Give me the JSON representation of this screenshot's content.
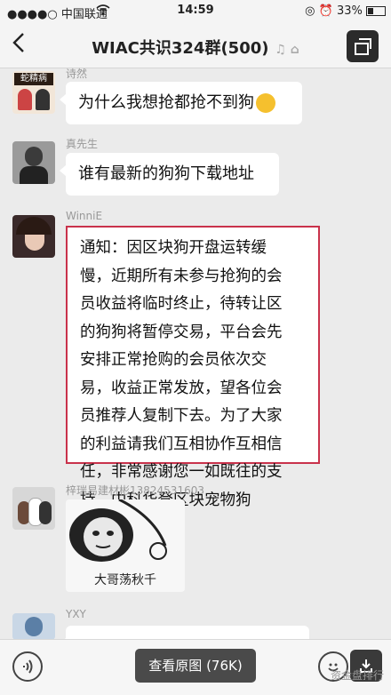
{
  "status_bar": {
    "carrier": "●●●●○ 中国联通",
    "time": "14:59",
    "battery": "33%"
  },
  "header": {
    "back_icon": "chevron-left",
    "title": "WIAC共识324群(500)",
    "more_icon": "window-switch-icon"
  },
  "messages": [
    {
      "sender": "诗然",
      "text": "为什么我想抢都抢不到狗"
    },
    {
      "sender": "真先生",
      "text": "谁有最新的狗狗下载地址"
    },
    {
      "sender": "WinniE",
      "lines": [
        "通知：因区块狗开盘运转缓",
        "慢，近期所有未参与抢狗的会",
        "员收益将临时终止，待转让区",
        "的狗狗将暂停交易，平台会先",
        "安排正常抢购的会员依次交",
        "易，收益正常发放，望各位会",
        "员推荐人复制下去。为了大家",
        "的利益请我们互相协作互相信",
        "任，非常感谢您一如既往的支",
        "持。中科华登区块宠物狗"
      ]
    },
    {
      "sender": "梓瑞易建材彬13824531603",
      "sticker_caption": "大哥荡秋千"
    },
    {
      "sender": "YXY"
    }
  ],
  "avatar1_text": "蛇精病",
  "bottom_bar": {
    "view_original_label": "查看原图 (76K)"
  },
  "watermark": "资金盘排行",
  "colors": {
    "notice_border": "#c9324b",
    "background": "#ebebeb"
  }
}
